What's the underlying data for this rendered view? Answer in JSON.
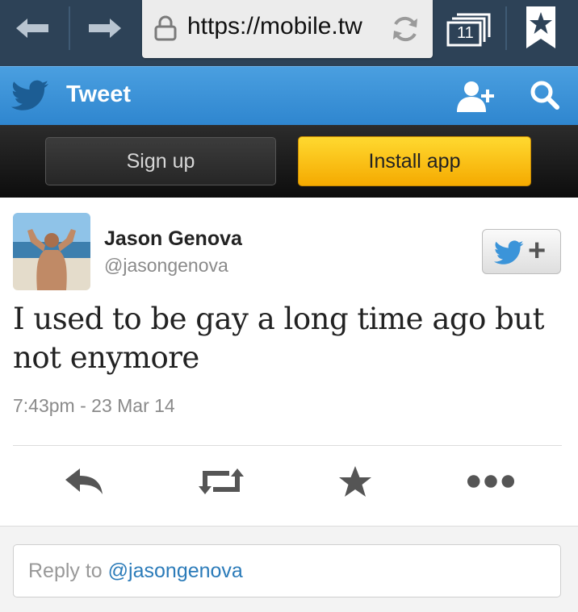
{
  "browser": {
    "url": "https://mobile.tw",
    "tab_count": "11",
    "icons": [
      "back-arrow-icon",
      "forward-arrow-icon",
      "lock-icon",
      "refresh-icon",
      "tabs-icon",
      "bookmark-star-icon"
    ]
  },
  "header": {
    "title": "Tweet",
    "icons": [
      "twitter-bird-icon",
      "add-user-icon",
      "search-icon"
    ],
    "background": "#3b94d9"
  },
  "actions": {
    "signup_label": "Sign up",
    "install_label": "Install app",
    "install_color": "#f9bd10"
  },
  "tweet": {
    "author_name": "Jason Genova",
    "author_handle": "@jasongenova",
    "text": "I used to be gay a long time ago but not enymore",
    "timestamp": "7:43pm - 23 Mar 14",
    "follow_plus": "+",
    "action_icons": [
      "reply-icon",
      "retweet-icon",
      "favorite-star-icon",
      "more-dots-icon"
    ]
  },
  "reply": {
    "prefix": "Reply to ",
    "mention": "@jasongenova"
  },
  "colors": {
    "browser_bar": "#2d4257",
    "link": "#2b7bb9",
    "muted_text": "#8a8a8a"
  }
}
